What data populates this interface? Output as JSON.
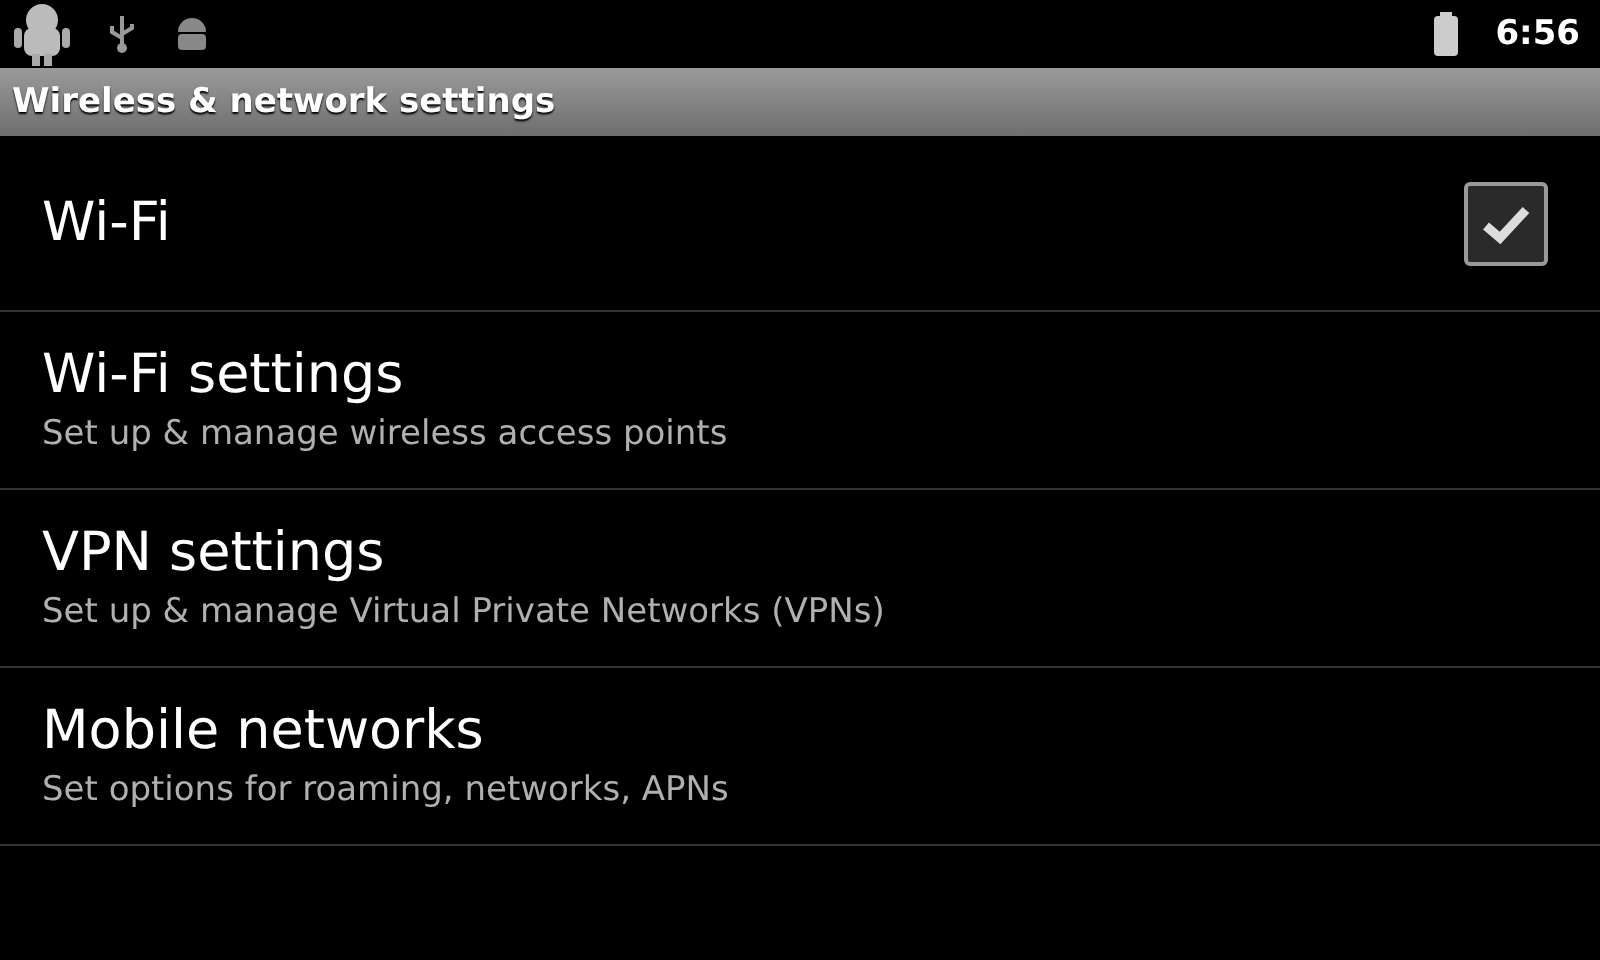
{
  "status_bar": {
    "time": "6:56"
  },
  "title_bar": {
    "title": "Wireless & network settings"
  },
  "settings": [
    {
      "kind": "checkbox",
      "title": "Wi-Fi",
      "checked": true
    },
    {
      "kind": "link",
      "title": "Wi-Fi settings",
      "summary": "Set up & manage wireless access points"
    },
    {
      "kind": "link",
      "title": "VPN settings",
      "summary": "Set up & manage Virtual Private Networks (VPNs)"
    },
    {
      "kind": "link",
      "title": "Mobile networks",
      "summary": "Set options for roaming, networks, APNs"
    }
  ]
}
